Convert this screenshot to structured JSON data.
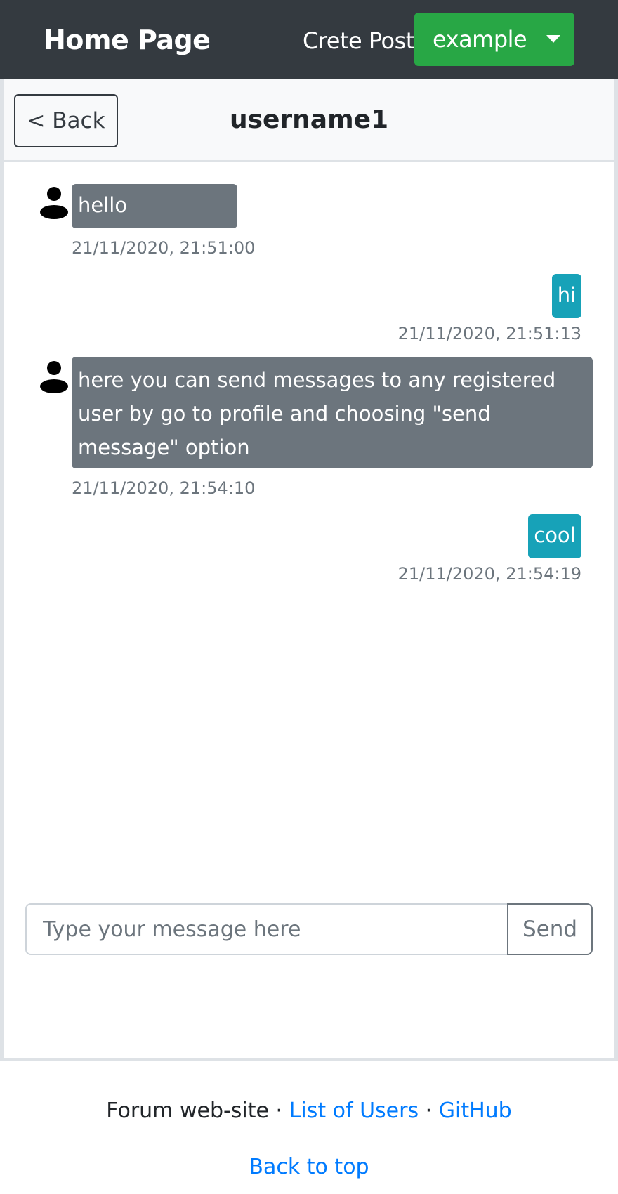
{
  "navbar": {
    "brand": "Home Page",
    "create_post": "Crete Post",
    "user_menu_label": "example",
    "user_menu_color": "#28a745",
    "background": "#343a40"
  },
  "chat": {
    "back_label": "< Back",
    "title": "username1",
    "messages": [
      {
        "direction": "received",
        "text": "hello",
        "timestamp": "21/11/2020, 21:51:00"
      },
      {
        "direction": "sent",
        "text": "hi",
        "timestamp": "21/11/2020, 21:51:13"
      },
      {
        "direction": "received",
        "text": "here you can send messages to any registered user by go to profile and choosing \"send message\" option",
        "timestamp": "21/11/2020, 21:54:10"
      },
      {
        "direction": "sent",
        "text": "cool",
        "timestamp": "21/11/2020, 21:54:19"
      }
    ],
    "input_placeholder": "Type your message here",
    "input_value": "",
    "send_label": "Send",
    "received_color": "#6c757d",
    "sent_color": "#17a2b8"
  },
  "footer": {
    "site_name": "Forum web-site",
    "separator": "·",
    "users_link": "List of Users",
    "github_link": "GitHub",
    "back_to_top": "Back to top",
    "link_color": "#007bff"
  },
  "icons": {
    "avatar": "person-icon",
    "dropdown": "caret-down-icon"
  }
}
